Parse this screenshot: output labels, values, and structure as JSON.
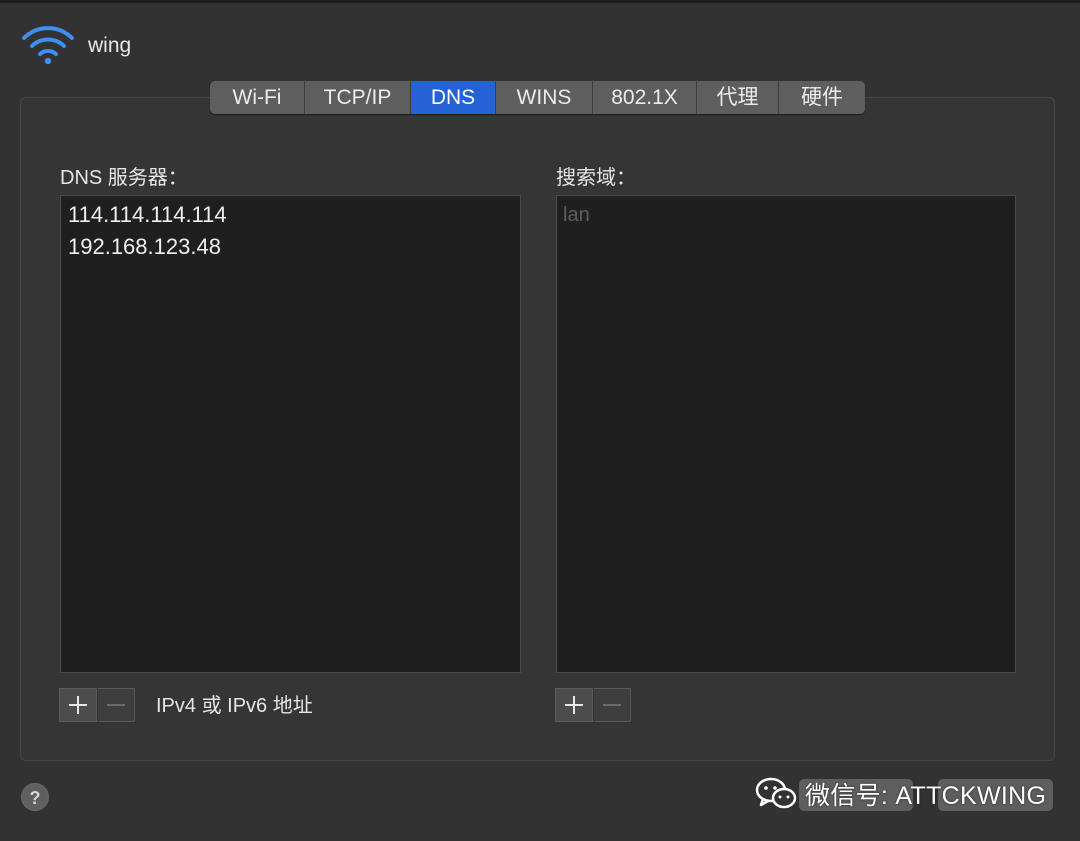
{
  "header": {
    "network_name": "wing",
    "icon": "wifi-icon"
  },
  "tabs": [
    {
      "label": "Wi-Fi",
      "active": false
    },
    {
      "label": "TCP/IP",
      "active": false
    },
    {
      "label": "DNS",
      "active": true
    },
    {
      "label": "WINS",
      "active": false
    },
    {
      "label": "802.1X",
      "active": false
    },
    {
      "label": "代理",
      "active": false
    },
    {
      "label": "硬件",
      "active": false
    }
  ],
  "dns": {
    "label": "DNS 服务器：",
    "servers": [
      "114.114.114.114",
      "192.168.123.48"
    ],
    "hint": "IPv4 或 IPv6 地址"
  },
  "search": {
    "label": "搜索域：",
    "placeholder": "lan"
  },
  "controls": {
    "add_icon": "plus-icon",
    "remove_icon": "minus-icon",
    "help": "?"
  },
  "watermark": {
    "text": "微信号: ATTCKWING",
    "icon": "wechat-icon"
  },
  "colors": {
    "accent": "#2463d6",
    "background": "#323232",
    "list_bg": "#1f1f1f"
  }
}
